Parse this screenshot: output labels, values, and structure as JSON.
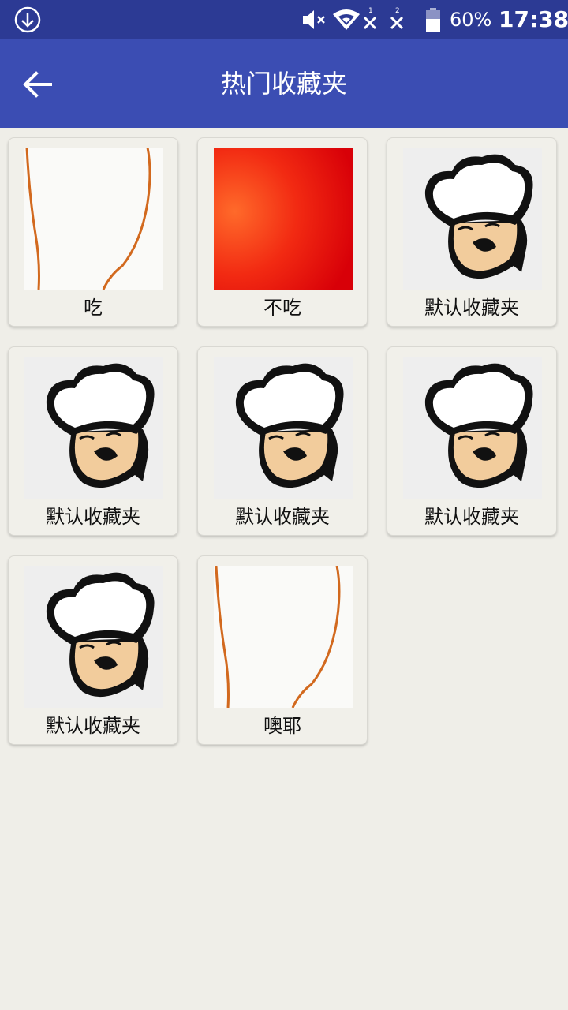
{
  "status_bar": {
    "battery_percent": "60%",
    "time": "17:38",
    "sim1_label": "1",
    "sim2_label": "2"
  },
  "app_bar": {
    "title": "热门收藏夹"
  },
  "folders": [
    {
      "label": "吃",
      "thumbnail": "white-drawing"
    },
    {
      "label": "不吃",
      "thumbnail": "red-gradient"
    },
    {
      "label": "默认收藏夹",
      "thumbnail": "chef-cartoon"
    },
    {
      "label": "默认收藏夹",
      "thumbnail": "chef-cartoon"
    },
    {
      "label": "默认收藏夹",
      "thumbnail": "chef-cartoon"
    },
    {
      "label": "默认收藏夹",
      "thumbnail": "chef-cartoon"
    },
    {
      "label": "默认收藏夹",
      "thumbnail": "chef-cartoon"
    },
    {
      "label": "噢耶",
      "thumbnail": "white-drawing"
    }
  ]
}
